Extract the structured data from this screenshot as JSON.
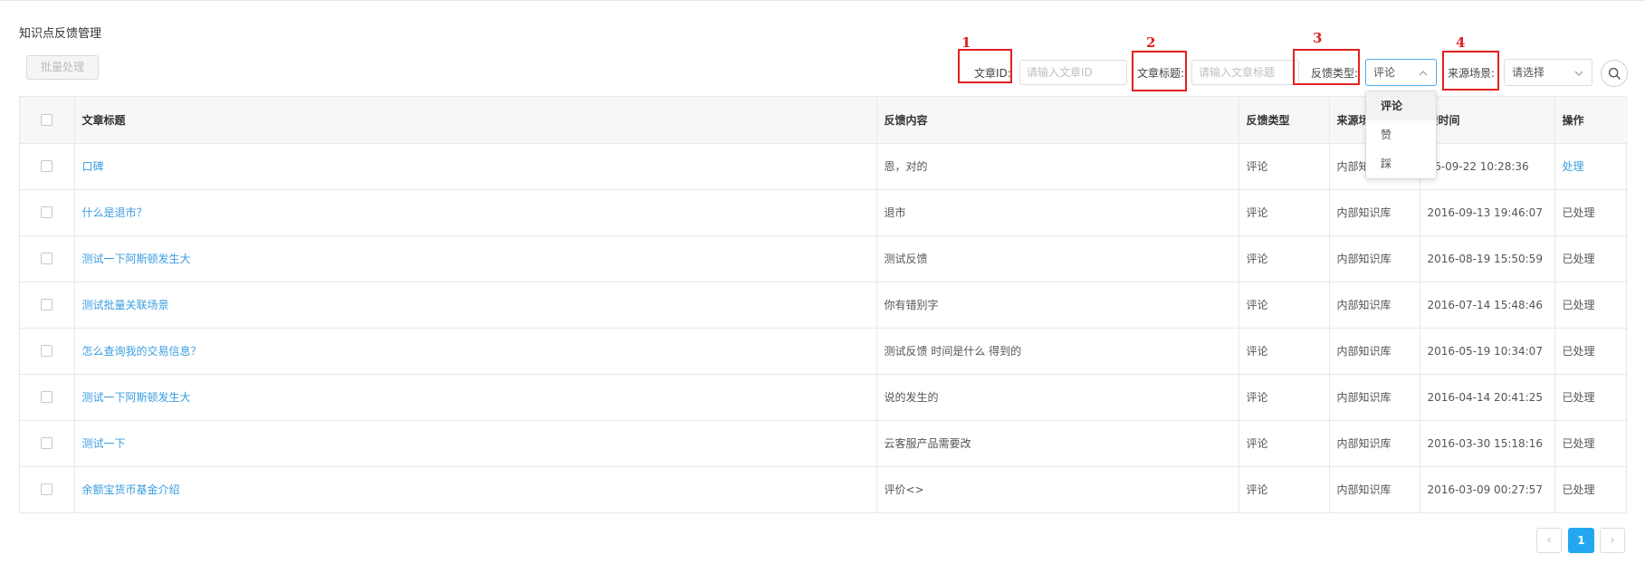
{
  "page_title": "知识点反馈管理",
  "toolbar": {
    "batch_label": "批量处理"
  },
  "filters": {
    "article_id": {
      "label": "文章ID",
      "placeholder": "请输入文章ID"
    },
    "article_title": {
      "label": "文章标题",
      "placeholder": "请输入文章标题"
    },
    "feedback_type": {
      "label": "反馈类型",
      "value": "评论",
      "options": [
        "评论",
        "赞",
        "踩"
      ]
    },
    "source_scene": {
      "label": "来源场景",
      "value": "请选择"
    }
  },
  "annotations": [
    "1",
    "2",
    "3",
    "4"
  ],
  "colors": {
    "accent": "#23a8ef",
    "link": "#3a9de0",
    "annotation": "#e32020"
  },
  "table": {
    "columns": [
      "文章标题",
      "反馈内容",
      "反馈类型",
      "来源场",
      "馈时间",
      "操作"
    ],
    "rows": [
      {
        "title": "口碑",
        "content": "恩，对的",
        "type": "评论",
        "source": "内部知",
        "time": "16-09-22 10:28:36",
        "action": "处理",
        "actionable": true
      },
      {
        "title": "什么是退市？",
        "content": "退市",
        "type": "评论",
        "source": "内部知识库",
        "time": "2016-09-13 19:46:07",
        "action": "已处理",
        "actionable": false
      },
      {
        "title": "测试一下阿斯顿发生大",
        "content": "测试反馈",
        "type": "评论",
        "source": "内部知识库",
        "time": "2016-08-19 15:50:59",
        "action": "已处理",
        "actionable": false
      },
      {
        "title": "测试批量关联场景",
        "content": "你有错别字",
        "type": "评论",
        "source": "内部知识库",
        "time": "2016-07-14 15:48:46",
        "action": "已处理",
        "actionable": false
      },
      {
        "title": "怎么查询我的交易信息？",
        "content": "测试反馈 时间是什么 得到的",
        "type": "评论",
        "source": "内部知识库",
        "time": "2016-05-19 10:34:07",
        "action": "已处理",
        "actionable": false
      },
      {
        "title": "测试一下阿斯顿发生大",
        "content": "说的发生的",
        "type": "评论",
        "source": "内部知识库",
        "time": "2016-04-14 20:41:25",
        "action": "已处理",
        "actionable": false
      },
      {
        "title": "测试一下",
        "content": "云客服产品需要改",
        "type": "评论",
        "source": "内部知识库",
        "time": "2016-03-30 15:18:16",
        "action": "已处理",
        "actionable": false
      },
      {
        "title": "余额宝货币基金介绍",
        "content": "评价<>",
        "type": "评论",
        "source": "内部知识库",
        "time": "2016-03-09 00:27:57",
        "action": "已处理",
        "actionable": false
      }
    ]
  },
  "pagination": {
    "current_page": "1",
    "prev": "‹",
    "next": "›"
  }
}
